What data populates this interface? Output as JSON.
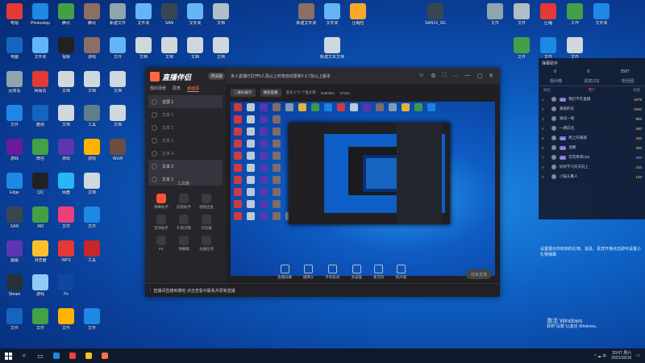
{
  "desktop_icons": [
    {
      "label": "电视",
      "color": "#e53935",
      "col": 0,
      "row": 0
    },
    {
      "label": "Photoshop",
      "color": "#1e88e5",
      "col": 1,
      "row": 0
    },
    {
      "label": "腾讯",
      "color": "#43a047",
      "col": 2,
      "row": 0
    },
    {
      "label": "腾讯",
      "color": "#8d6e63",
      "col": 3,
      "row": 0
    },
    {
      "label": "新建文件",
      "color": "#90a4ae",
      "col": 4,
      "row": 0
    },
    {
      "label": "文件夹",
      "color": "#64b5f6",
      "col": 5,
      "row": 0
    },
    {
      "label": "SAN",
      "color": "#37474f",
      "col": 6,
      "row": 0
    },
    {
      "label": "文件夹",
      "color": "#64b5f6",
      "col": 7,
      "row": 0
    },
    {
      "label": "文档",
      "color": "#b0bec5",
      "col": 8,
      "row": 0
    },
    {
      "label": "新建文件夹",
      "color": "#8d6e63",
      "col": 11,
      "row": 0
    },
    {
      "label": "文件夹",
      "color": "#64b5f6",
      "col": 12,
      "row": 0
    },
    {
      "label": "压缩包",
      "color": "#f9a825",
      "col": 13,
      "row": 0
    },
    {
      "label": "SAN14_SG",
      "color": "#37474f",
      "col": 16,
      "row": 0
    },
    {
      "label": "文件",
      "color": "#90a4ae",
      "col": 18,
      "row": 0
    },
    {
      "label": "文件",
      "color": "#b0bec5",
      "col": 19,
      "row": 0
    },
    {
      "label": "压缩",
      "color": "#e53935",
      "col": 20,
      "row": 0
    },
    {
      "label": "工作",
      "color": "#43a047",
      "col": 21,
      "row": 0
    },
    {
      "label": "文件夹",
      "color": "#1e88e5",
      "col": 22,
      "row": 0
    },
    {
      "label": "电脑",
      "color": "#1565c0",
      "col": 0,
      "row": 1
    },
    {
      "label": "文件夹",
      "color": "#64b5f6",
      "col": 1,
      "row": 1
    },
    {
      "label": "视频",
      "color": "#212121",
      "col": 2,
      "row": 1
    },
    {
      "label": "游戏",
      "color": "#8d6e63",
      "col": 3,
      "row": 1
    },
    {
      "label": "文件",
      "color": "#64b5f6",
      "col": 4,
      "row": 1
    },
    {
      "label": "文档",
      "color": "#cfd8dc",
      "col": 5,
      "row": 1
    },
    {
      "label": "文档",
      "color": "#cfd8dc",
      "col": 6,
      "row": 1
    },
    {
      "label": "文档",
      "color": "#cfd8dc",
      "col": 7,
      "row": 1
    },
    {
      "label": "文档",
      "color": "#cfd8dc",
      "col": 8,
      "row": 1
    },
    {
      "label": "新建文本文档",
      "color": "#cfd8dc",
      "col": 12,
      "row": 1
    },
    {
      "label": "文件",
      "color": "#43a047",
      "col": 19,
      "row": 1
    },
    {
      "label": "文件",
      "color": "#1e88e5",
      "col": 20,
      "row": 1
    },
    {
      "label": "文件",
      "color": "#cfd8dc",
      "col": 21,
      "row": 1
    },
    {
      "label": "回收站",
      "color": "#90a4ae",
      "col": 0,
      "row": 2
    },
    {
      "label": "网易云",
      "color": "#e53935",
      "col": 1,
      "row": 2
    },
    {
      "label": "文档",
      "color": "#cfd8dc",
      "col": 2,
      "row": 2
    },
    {
      "label": "文档",
      "color": "#cfd8dc",
      "col": 3,
      "row": 2
    },
    {
      "label": "文档",
      "color": "#cfd8dc",
      "col": 4,
      "row": 2
    },
    {
      "label": "文件",
      "color": "#1e88e5",
      "col": 0,
      "row": 3
    },
    {
      "label": "酷狗",
      "color": "#1565c0",
      "col": 1,
      "row": 3
    },
    {
      "label": "文档",
      "color": "#cfd8dc",
      "col": 2,
      "row": 3
    },
    {
      "label": "工具",
      "color": "#607d8b",
      "col": 3,
      "row": 3
    },
    {
      "label": "文档",
      "color": "#cfd8dc",
      "col": 4,
      "row": 3
    },
    {
      "label": "游戏",
      "color": "#6a1b9a",
      "col": 0,
      "row": 4
    },
    {
      "label": "微信",
      "color": "#43a047",
      "col": 1,
      "row": 4
    },
    {
      "label": "游戏",
      "color": "#5e35b1",
      "col": 2,
      "row": 4
    },
    {
      "label": "游戏",
      "color": "#ffb300",
      "col": 3,
      "row": 4
    },
    {
      "label": "WoW",
      "color": "#6d4c41",
      "col": 4,
      "row": 4
    },
    {
      "label": "Edge",
      "color": "#1e88e5",
      "col": 0,
      "row": 5
    },
    {
      "label": "QQ",
      "color": "#212121",
      "col": 1,
      "row": 5
    },
    {
      "label": "网盘",
      "color": "#29b6f6",
      "col": 2,
      "row": 5
    },
    {
      "label": "文档",
      "color": "#cfd8dc",
      "col": 3,
      "row": 5
    },
    {
      "label": "SAN",
      "color": "#37474f",
      "col": 0,
      "row": 6
    },
    {
      "label": "360",
      "color": "#43a047",
      "col": 1,
      "row": 6
    },
    {
      "label": "文件",
      "color": "#ec407a",
      "col": 2,
      "row": 6
    },
    {
      "label": "文件",
      "color": "#1e88e5",
      "col": 3,
      "row": 6
    },
    {
      "label": "画图",
      "color": "#5e35b1",
      "col": 0,
      "row": 7
    },
    {
      "label": "浏览器",
      "color": "#fbc02d",
      "col": 1,
      "row": 7
    },
    {
      "label": "WPS",
      "color": "#e53935",
      "col": 2,
      "row": 7
    },
    {
      "label": "工具",
      "color": "#c62828",
      "col": 3,
      "row": 7
    },
    {
      "label": "Steam",
      "color": "#263238",
      "col": 0,
      "row": 8
    },
    {
      "label": "游戏",
      "color": "#90caf9",
      "col": 1,
      "row": 8
    },
    {
      "label": "Ps",
      "color": "#0d47a1",
      "col": 2,
      "row": 8
    },
    {
      "label": "文件",
      "color": "#1565c0",
      "col": 0,
      "row": 9
    },
    {
      "label": "文件",
      "color": "#43a047",
      "col": 1,
      "row": 9
    },
    {
      "label": "文件",
      "color": "#ffb300",
      "col": 2,
      "row": 9
    },
    {
      "label": "文件",
      "color": "#1e88e5",
      "col": 3,
      "row": 9
    }
  ],
  "live_window": {
    "logo": "直播伴侣",
    "version": "测试版",
    "left_tabs": [
      "我的场景",
      "层表",
      "画面源"
    ],
    "scenes": [
      "全屏 1",
      "文本 1",
      "文本 2",
      "文本 3",
      "文本 4",
      "文本 2",
      "文本 1"
    ],
    "tools_title": "工具箱",
    "tools": [
      "弹幕助手",
      "房管助手",
      "视频连麦",
      "音效助手",
      "礼物点歌",
      "浏览器",
      "PK",
      "弹幕箱",
      "主播任务"
    ],
    "title": "多人直播已打开5人及以上时将自动更新5.3.7及以上版本",
    "top_controls": [
      "☺",
      "⚙",
      "⛶",
      "⋯",
      "—",
      "▢",
      "✕"
    ],
    "sub_chips": [
      "二维码展示",
      "横屏直播"
    ],
    "sub_info": [
      "音乐人气 个电大帮",
      "8480851",
      "37316"
    ],
    "bottom_buttons": [
      "直播屏幕",
      "摄像头",
      "手机投屏",
      "多画面",
      "麦克风",
      "扬声器"
    ],
    "start_live": "结束直播",
    "footer_warning": "!",
    "footer_text": "直播间直播到期啦 点击查看可联系并更新直播"
  },
  "side_panel": {
    "header": "弹幕助手",
    "stats": [
      "0",
      "0",
      "2587"
    ],
    "tabs": [
      "观众榜",
      "贵宾(33)",
      "粉丝团"
    ],
    "cols": [
      "排名",
      "用户",
      "贡献"
    ],
    "rows": [
      {
        "rank": "1",
        "lvl": "Lv",
        "name": "我们不在直播",
        "val": "1679",
        "blue": false
      },
      {
        "rank": "2",
        "lvl": "",
        "name": "黄鹤的天",
        "val": "1000",
        "blue": false
      },
      {
        "rank": "3",
        "lvl": "",
        "name": "湖北一线",
        "val": "800",
        "blue": false
      },
      {
        "rank": "4",
        "lvl": "",
        "name": "一路向北",
        "val": "560",
        "blue": false
      },
      {
        "rank": "5",
        "lvl": "Lv",
        "name": "爬上的满城",
        "val": "420",
        "blue": false
      },
      {
        "rank": "6",
        "lvl": "Lv",
        "name": "温暖",
        "val": "350",
        "blue": false
      },
      {
        "rank": "7",
        "lvl": "Lv",
        "name": "花花草草(18)",
        "val": "300",
        "blue": true
      },
      {
        "rank": "8",
        "lvl": "",
        "name": "好好学习天天向上",
        "val": "210",
        "blue": false
      },
      {
        "rank": "9",
        "lvl": "",
        "name": "小猫头鹰人",
        "val": "120",
        "blue": false
      }
    ]
  },
  "notice": "设置展示你收到的礼物、道具、贵宾开通点击即可设置小礼物弹幕",
  "activate": {
    "title": "激活 Windows",
    "line": "转到\"设置\"以激活 Windows。"
  },
  "taskbar": {
    "apps": [
      {
        "icon": "search-icon",
        "glyph": "⌕"
      },
      {
        "icon": "task-view-icon",
        "glyph": "▭"
      },
      {
        "icon": "edge-icon",
        "color": "#1e88e5"
      },
      {
        "icon": "chrome-icon",
        "color": "#f44336"
      },
      {
        "icon": "folder-icon",
        "color": "#fbc02d"
      },
      {
        "icon": "live-app-icon",
        "color": "#ff7043"
      }
    ],
    "tray_text": "^ ☁ 中",
    "time": "20:07 周六",
    "date": "2021/10/16"
  }
}
